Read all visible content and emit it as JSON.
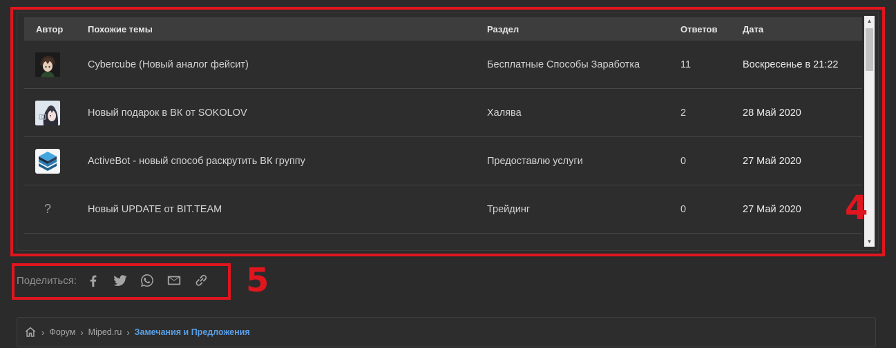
{
  "annotations": {
    "box4_label": "4",
    "box5_label": "5"
  },
  "table": {
    "headers": {
      "author": "Автор",
      "title": "Похожие темы",
      "forum": "Раздел",
      "replies": "Ответов",
      "date": "Дата"
    },
    "rows": [
      {
        "title": "Cybercube (Новый аналог фейсит)",
        "forum": "Бесплатные Способы Заработка",
        "replies": "11",
        "date": "Воскресенье в 21:22",
        "avatar": "anime-avatar-dark"
      },
      {
        "title": "Новый подарок в ВК от SOKOLOV",
        "forum": "Халява",
        "replies": "2",
        "date": "28 Май 2020",
        "avatar": "anime-avatar-light"
      },
      {
        "title": "ActiveBot - новый способ раскрутить ВК группу",
        "forum": "Предоставлю услуги",
        "replies": "0",
        "date": "27 Май 2020",
        "avatar": "layers-logo"
      },
      {
        "title": "Новый UPDATE от BIT.TEAM",
        "forum": "Трейдинг",
        "replies": "0",
        "date": "27 Май 2020",
        "avatar": "question-mark",
        "avatar_text": "?"
      }
    ]
  },
  "share": {
    "label": "Поделиться:",
    "icons": [
      "facebook-icon",
      "twitter-icon",
      "whatsapp-icon",
      "email-icon",
      "link-icon"
    ]
  },
  "breadcrumb": {
    "items": [
      "Форум",
      "Miped.ru"
    ],
    "current": "Замечания и Предложения",
    "current_color": "#5b9fe6"
  },
  "colors": {
    "annotation_red": "#e0161f",
    "background": "#2b2b2b",
    "header_bg": "#3d3d3d"
  }
}
